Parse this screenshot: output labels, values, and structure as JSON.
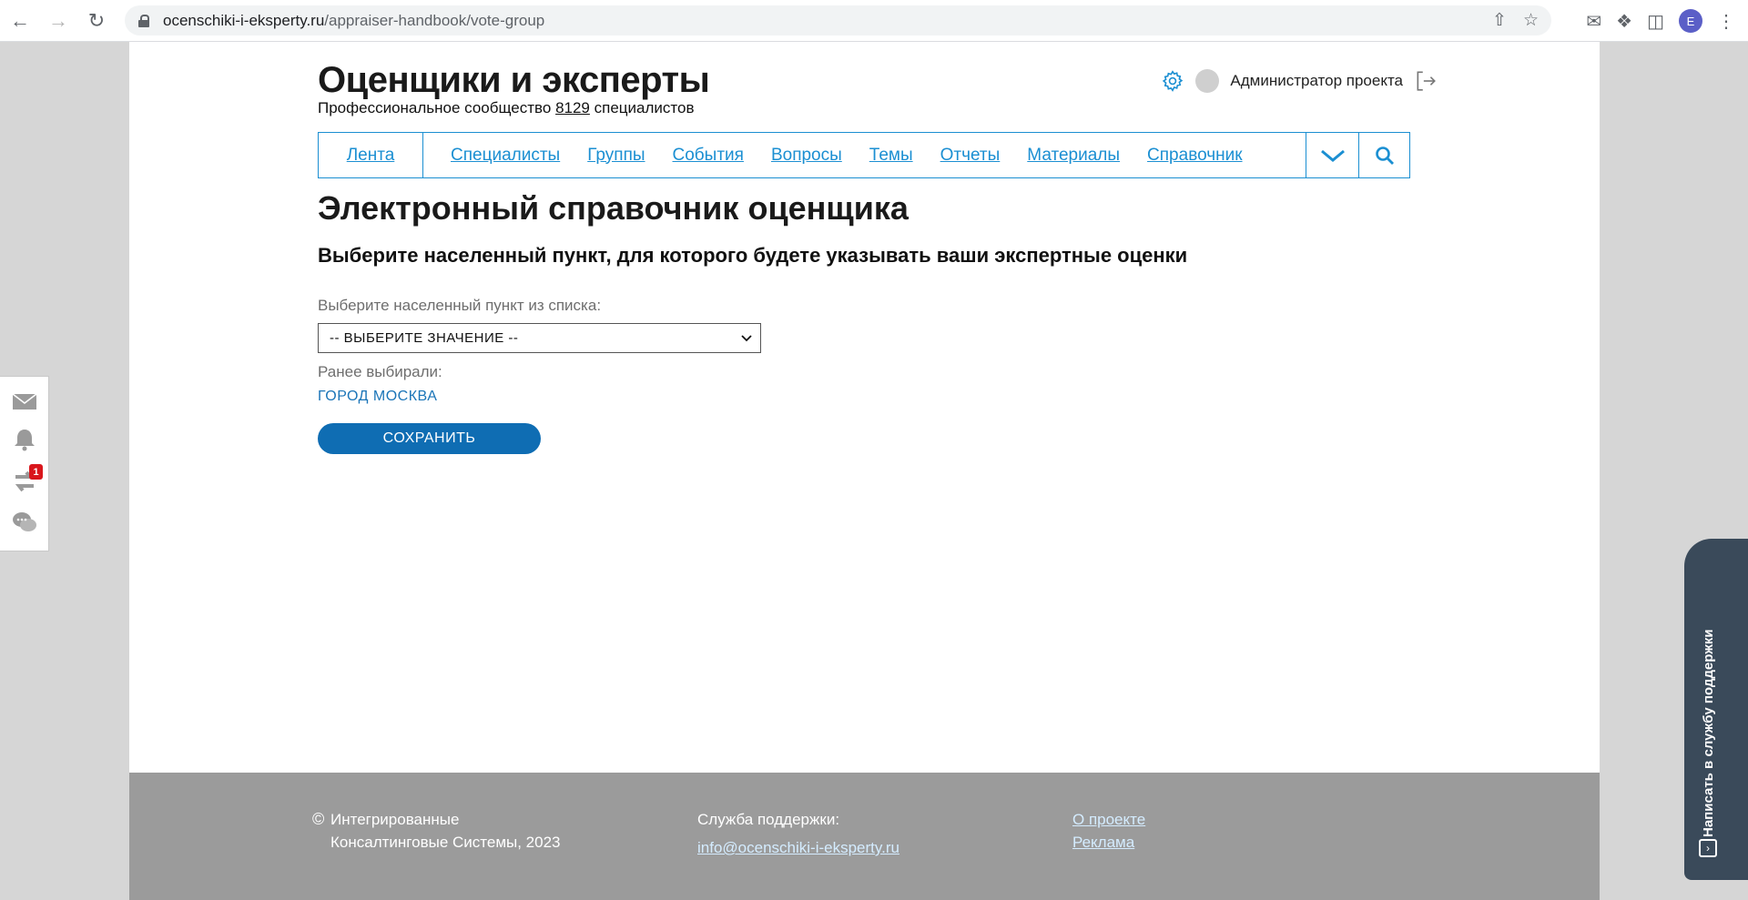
{
  "browser": {
    "url_domain": "ocenschiki-i-eksperty.ru",
    "url_path": "/appraiser-handbook/vote-group",
    "profile_initial": "E"
  },
  "header": {
    "logo": "Оценщики и эксперты",
    "tagline_prefix": "Профессиональное сообщество",
    "tagline_count": "8129",
    "tagline_suffix": "специалистов",
    "user_name": "Администратор проекта"
  },
  "nav": {
    "first": "Лента",
    "items": [
      "Специалисты",
      "Группы",
      "События",
      "Вопросы",
      "Темы",
      "Отчеты",
      "Материалы",
      "Справочник"
    ]
  },
  "main": {
    "title": "Электронный справочник оценщика",
    "subtitle": "Выберите населенный пункт, для которого будете указывать ваши экспертные оценки",
    "select_label": "Выберите населенный пункт из списка:",
    "select_value": "-- ВЫБЕРИТЕ ЗНАЧЕНИЕ --",
    "prev_label": "Ранее выбирали:",
    "prev_value": "ГОРОД МОСКВА",
    "save_label": "СОХРАНИТЬ"
  },
  "footer": {
    "copy_symbol": "©",
    "copy_line1": "Интегрированные",
    "copy_line2": "Консалтинговые Системы, 2023",
    "support_label": "Служба поддержки:",
    "support_email": "info@ocenschiki-i-eksperty.ru",
    "link_about": "О проекте",
    "link_ads": "Реклама"
  },
  "side_panel": {
    "badge_count": "1"
  },
  "support_tab": {
    "label": "Написать в службу поддержки"
  },
  "colors": {
    "accent": "#1b8fd2",
    "button": "#0f6db3",
    "footer": "#9b9b9b",
    "badge": "#d9161c",
    "support_tab": "#3a4a5a"
  }
}
